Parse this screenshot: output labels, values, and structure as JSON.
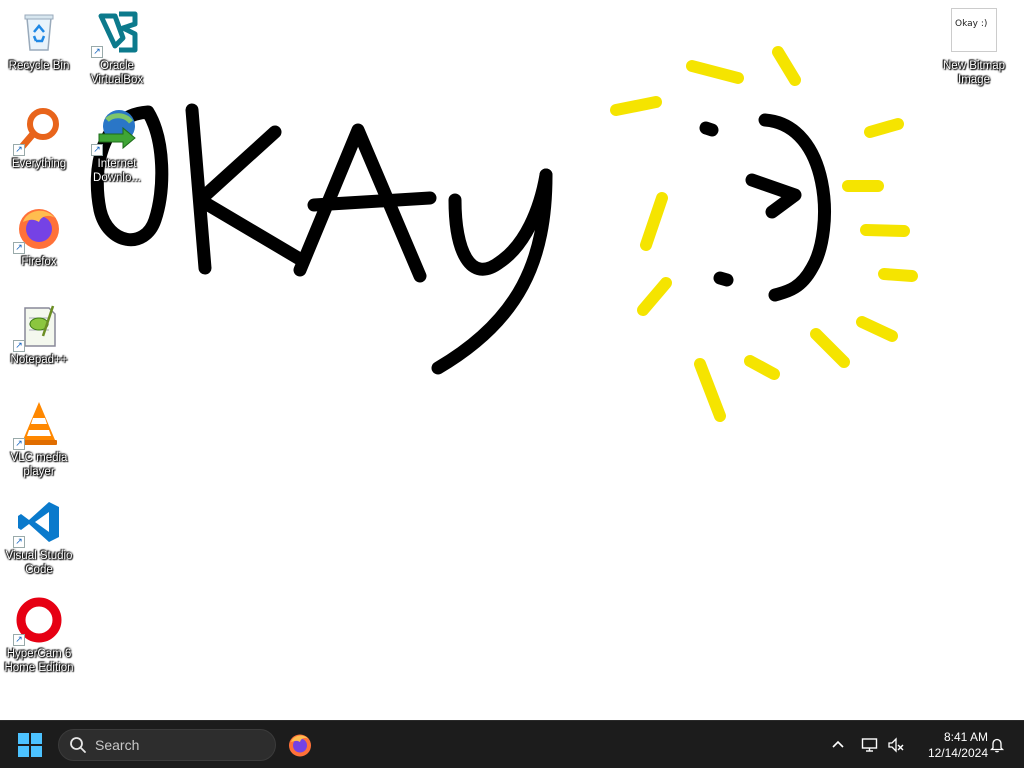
{
  "desktop_icons": [
    {
      "id": "recycle-bin",
      "label": "Recycle Bin",
      "icon": "recycle-bin-icon"
    },
    {
      "id": "oracle-virtualbox",
      "label": "Oracle\nVirtualBox",
      "icon": "virtualbox-icon"
    },
    {
      "id": "everything",
      "label": "Everything",
      "icon": "everything-search-icon"
    },
    {
      "id": "internet-download-manager",
      "label": "Internet\nDownlo...",
      "icon": "idm-icon"
    },
    {
      "id": "firefox",
      "label": "Firefox",
      "icon": "firefox-icon"
    },
    {
      "id": "notepad-plus-plus",
      "label": "Notepad++",
      "icon": "notepad-plus-plus-icon"
    },
    {
      "id": "vlc",
      "label": "VLC media\nplayer",
      "icon": "vlc-icon"
    },
    {
      "id": "vscode",
      "label": "Visual Studio\nCode",
      "icon": "vscode-icon"
    },
    {
      "id": "hypercam",
      "label": "HyperCam 6\nHome Edition",
      "icon": "hypercam-icon"
    },
    {
      "id": "new-bitmap-image",
      "label": "New Bitmap\nImage",
      "icon": "bitmap-thumbnail-icon"
    }
  ],
  "wallpaper": {
    "text": "OKAY",
    "ink_color": "#000000",
    "sun_color": "#f5e400"
  },
  "bitmap_thumbnail_text": "Okay :)",
  "taskbar": {
    "search_placeholder": "Search",
    "pinned": [
      "firefox-icon"
    ],
    "tray": {
      "overflow_icon": "chevron-up-icon",
      "network_icon": "network-icon",
      "volume_icon": "volume-muted-icon",
      "notification_icon": "bell-icon"
    },
    "clock": {
      "time": "8:41 AM",
      "date": "12/14/2024"
    }
  },
  "colors": {
    "taskbar": "#1c1c1c",
    "search_bg": "#2d2d2d",
    "desktop_bg": "#ffffff"
  }
}
